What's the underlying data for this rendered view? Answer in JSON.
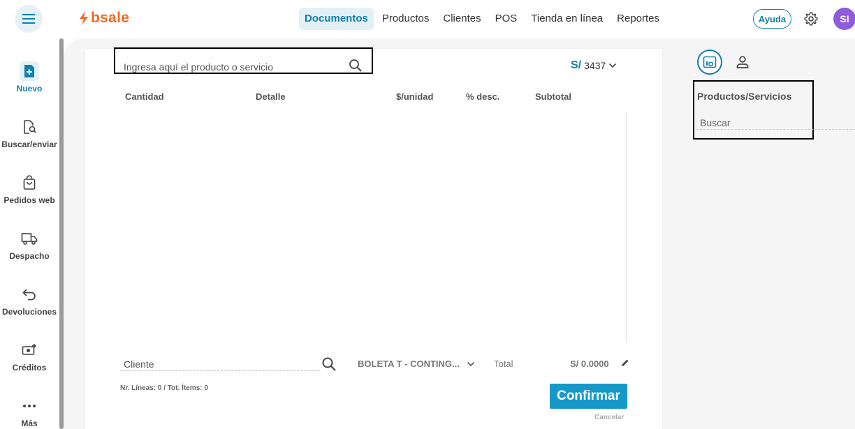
{
  "header": {
    "logo_text": "bsale",
    "nav": [
      {
        "label": "Documentos",
        "active": true
      },
      {
        "label": "Productos"
      },
      {
        "label": "Clientes"
      },
      {
        "label": "POS"
      },
      {
        "label": "Tienda en línea"
      },
      {
        "label": "Reportes"
      }
    ],
    "help_label": "Ayuda",
    "avatar_initials": "SI"
  },
  "sidebar": {
    "items": [
      {
        "label": "Nuevo",
        "icon": "new-document-icon",
        "active": true
      },
      {
        "label": "Buscar/enviar",
        "icon": "search-document-icon"
      },
      {
        "label": "Pedidos web",
        "icon": "shopping-bag-icon"
      },
      {
        "label": "Despacho",
        "icon": "truck-icon"
      },
      {
        "label": "Devoluciones",
        "icon": "return-arrow-icon"
      },
      {
        "label": "Créditos",
        "icon": "credit-icon"
      },
      {
        "label": "Más",
        "icon": "more-dots-icon"
      }
    ]
  },
  "document": {
    "search_placeholder": "Ingresa aquí el producto o servicio",
    "currency_symbol": "S/",
    "currency_code": "3437",
    "columns": [
      "Cantidad",
      "Detalle",
      "$/unidad",
      "% desc.",
      "Subtotal"
    ],
    "client_placeholder": "Cliente",
    "doc_type": "BOLETA T - CONTING...",
    "total_label": "Total",
    "total_value": "S/ 0.0000",
    "lines_info": "Nr. Líneas: 0 / Tot. Ítems: 0",
    "confirm_label": "Confirmar",
    "cancel_label": "Cancelar"
  },
  "right_panel": {
    "title": "Productos/Servicios",
    "search_placeholder": "Buscar"
  },
  "colors": {
    "brand": "#f26a21",
    "accent": "#127fa8",
    "confirm": "#1699c9",
    "avatar": "#8e5cdc"
  }
}
